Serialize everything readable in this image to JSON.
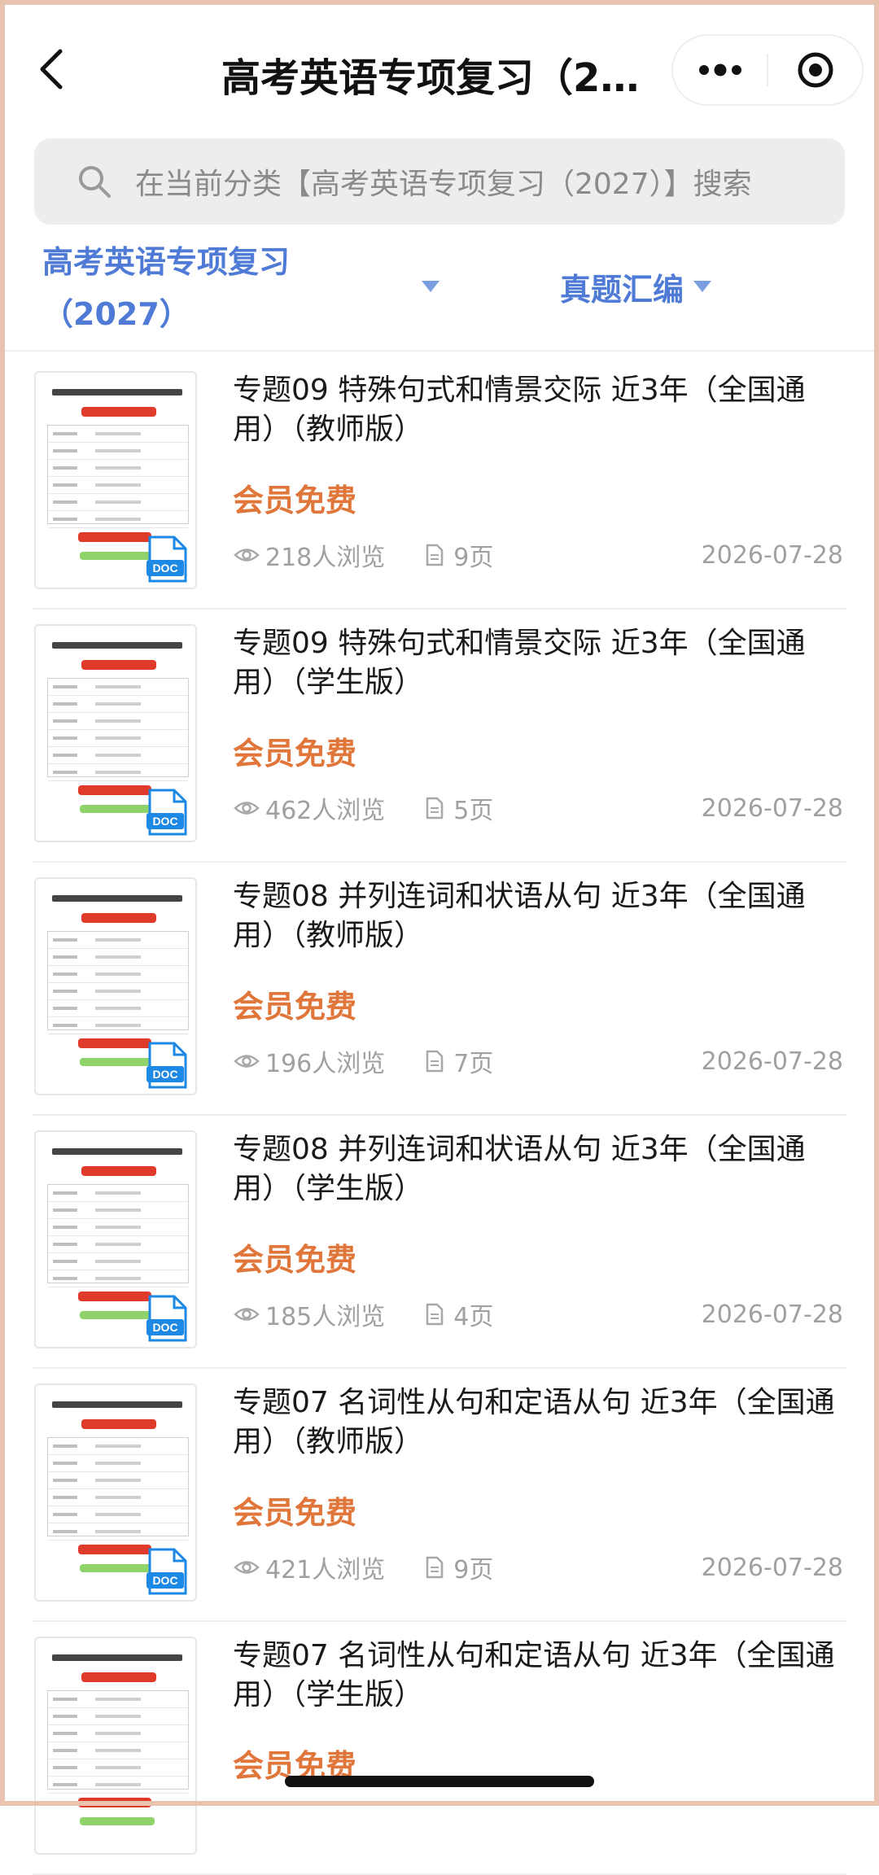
{
  "nav": {
    "title": "高考英语专项复习（20...",
    "back_icon": "chevron-left-icon",
    "more_icon": "more-dots-icon",
    "record_icon": "target-icon"
  },
  "search": {
    "placeholder": "在当前分类【高考英语专项复习（2027）】搜索"
  },
  "filters": {
    "category": "高考英语专项复习（2027）",
    "type": "真题汇编",
    "accent": "#4f7bd6"
  },
  "colors": {
    "price": "#e0763a",
    "meta": "#a0a0a0",
    "doc_badge": "#1e88e5"
  },
  "items": [
    {
      "title": "专题09 特殊句式和情景交际 近3年（全国通用）（教师版）",
      "price": "会员免费",
      "views": "218人浏览",
      "pages": "9页",
      "date": "2026-07-28",
      "badge": "DOC"
    },
    {
      "title": "专题09 特殊句式和情景交际 近3年（全国通用）（学生版）",
      "price": "会员免费",
      "views": "462人浏览",
      "pages": "5页",
      "date": "2026-07-28",
      "badge": "DOC"
    },
    {
      "title": "专题08 并列连词和状语从句 近3年（全国通用）（教师版）",
      "price": "会员免费",
      "views": "196人浏览",
      "pages": "7页",
      "date": "2026-07-28",
      "badge": "DOC"
    },
    {
      "title": "专题08 并列连词和状语从句 近3年（全国通用）（学生版）",
      "price": "会员免费",
      "views": "185人浏览",
      "pages": "4页",
      "date": "2026-07-28",
      "badge": "DOC"
    },
    {
      "title": "专题07 名词性从句和定语从句 近3年（全国通用）（教师版）",
      "price": "会员免费",
      "views": "421人浏览",
      "pages": "9页",
      "date": "2026-07-28",
      "badge": "DOC"
    },
    {
      "title": "专题07 名词性从句和定语从句 近3年（全国通用）（学生版）",
      "price": "会员免费",
      "views": "",
      "pages": "",
      "date": "",
      "badge": ""
    }
  ]
}
